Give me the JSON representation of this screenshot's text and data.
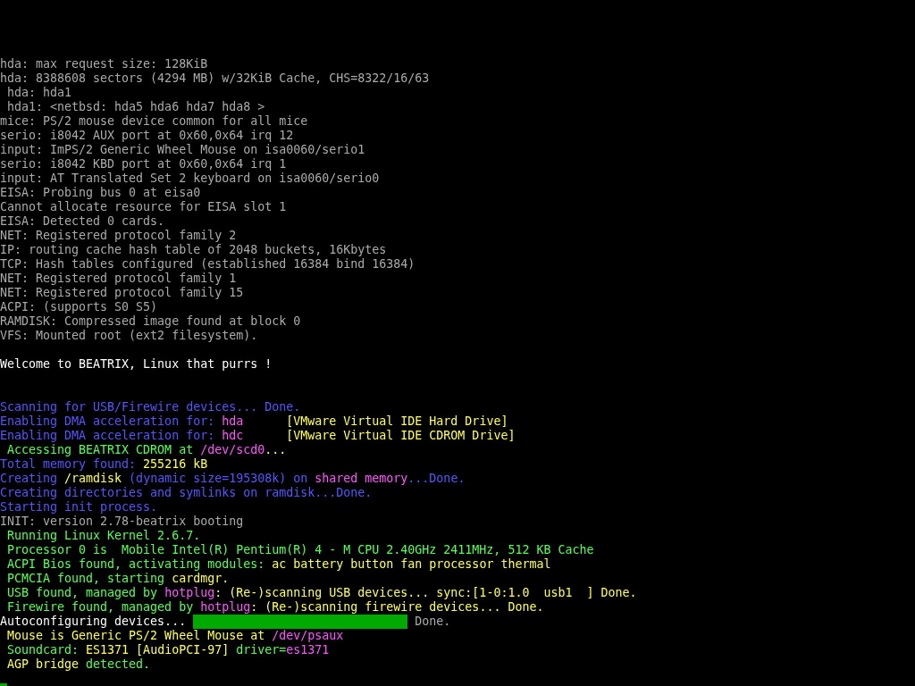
{
  "console": {
    "lines": [
      {
        "kind": "blank"
      },
      {
        "kind": "blank"
      },
      {
        "kind": "blank"
      },
      {
        "kind": "blank"
      },
      {
        "kind": "text",
        "segments": [
          {
            "text": "hda: max request size: 128KiB",
            "color": "#aaaaaa"
          }
        ]
      },
      {
        "kind": "text",
        "segments": [
          {
            "text": "hda: 8388608 sectors (4294 MB) w/32KiB Cache, CHS=8322/16/63",
            "color": "#aaaaaa"
          }
        ]
      },
      {
        "kind": "text",
        "segments": [
          {
            "text": " hda: hda1",
            "color": "#aaaaaa"
          }
        ]
      },
      {
        "kind": "text",
        "segments": [
          {
            "text": " hda1: <netbsd: hda5 hda6 hda7 hda8 >",
            "color": "#aaaaaa"
          }
        ]
      },
      {
        "kind": "text",
        "segments": [
          {
            "text": "mice: PS/2 mouse device common for all mice",
            "color": "#aaaaaa"
          }
        ]
      },
      {
        "kind": "text",
        "segments": [
          {
            "text": "serio: i8042 AUX port at 0x60,0x64 irq 12",
            "color": "#aaaaaa"
          }
        ]
      },
      {
        "kind": "text",
        "segments": [
          {
            "text": "input: ImPS/2 Generic Wheel Mouse on isa0060/serio1",
            "color": "#aaaaaa"
          }
        ]
      },
      {
        "kind": "text",
        "segments": [
          {
            "text": "serio: i8042 KBD port at 0x60,0x64 irq 1",
            "color": "#aaaaaa"
          }
        ]
      },
      {
        "kind": "text",
        "segments": [
          {
            "text": "input: AT Translated Set 2 keyboard on isa0060/serio0",
            "color": "#aaaaaa"
          }
        ]
      },
      {
        "kind": "text",
        "segments": [
          {
            "text": "EISA: Probing bus 0 at eisa0",
            "color": "#aaaaaa"
          }
        ]
      },
      {
        "kind": "text",
        "segments": [
          {
            "text": "Cannot allocate resource for EISA slot 1",
            "color": "#aaaaaa"
          }
        ]
      },
      {
        "kind": "text",
        "segments": [
          {
            "text": "EISA: Detected 0 cards.",
            "color": "#aaaaaa"
          }
        ]
      },
      {
        "kind": "text",
        "segments": [
          {
            "text": "NET: Registered protocol family 2",
            "color": "#aaaaaa"
          }
        ]
      },
      {
        "kind": "text",
        "segments": [
          {
            "text": "IP: routing cache hash table of 2048 buckets, 16Kbytes",
            "color": "#aaaaaa"
          }
        ]
      },
      {
        "kind": "text",
        "segments": [
          {
            "text": "TCP: Hash tables configured (established 16384 bind 16384)",
            "color": "#aaaaaa"
          }
        ]
      },
      {
        "kind": "text",
        "segments": [
          {
            "text": "NET: Registered protocol family 1",
            "color": "#aaaaaa"
          }
        ]
      },
      {
        "kind": "text",
        "segments": [
          {
            "text": "NET: Registered protocol family 15",
            "color": "#aaaaaa"
          }
        ]
      },
      {
        "kind": "text",
        "segments": [
          {
            "text": "ACPI: (supports S0 S5)",
            "color": "#aaaaaa"
          }
        ]
      },
      {
        "kind": "text",
        "segments": [
          {
            "text": "RAMDISK: Compressed image found at block 0",
            "color": "#aaaaaa"
          }
        ]
      },
      {
        "kind": "text",
        "segments": [
          {
            "text": "VFS: Mounted root (ext2 filesystem).",
            "color": "#aaaaaa"
          }
        ]
      },
      {
        "kind": "blank"
      },
      {
        "kind": "text",
        "segments": [
          {
            "text": "Welcome to BEATRIX, Linux that purrs !",
            "color": "#ffffff"
          }
        ]
      },
      {
        "kind": "blank"
      },
      {
        "kind": "blank"
      },
      {
        "kind": "text",
        "segments": [
          {
            "text": "Scanning for USB/Firewire devices... Done.",
            "color": "#5555ff"
          }
        ]
      },
      {
        "kind": "text",
        "segments": [
          {
            "text": "Enabling DMA acceleration for: ",
            "color": "#5555ff"
          },
          {
            "text": "hda      ",
            "color": "#ff55ff"
          },
          {
            "text": "[VMware Virtual IDE Hard Drive]",
            "color": "#ffff55"
          }
        ]
      },
      {
        "kind": "text",
        "segments": [
          {
            "text": "Enabling DMA acceleration for: ",
            "color": "#5555ff"
          },
          {
            "text": "hdc      ",
            "color": "#ff55ff"
          },
          {
            "text": "[VMware Virtual IDE CDROM Drive]",
            "color": "#ffff55"
          }
        ]
      },
      {
        "kind": "text",
        "segments": [
          {
            "text": " Accessing BEATRIX CDROM at ",
            "color": "#55ff55"
          },
          {
            "text": "/dev/scd0",
            "color": "#ff55ff"
          },
          {
            "text": "...",
            "color": "#ffff55"
          }
        ]
      },
      {
        "kind": "text",
        "segments": [
          {
            "text": "Total memory found: ",
            "color": "#5555ff"
          },
          {
            "text": "255216 kB",
            "color": "#ffff55"
          }
        ]
      },
      {
        "kind": "text",
        "segments": [
          {
            "text": "Creating ",
            "color": "#5555ff"
          },
          {
            "text": "/ramdisk",
            "color": "#ffff55"
          },
          {
            "text": " (dynamic size=195308k) on ",
            "color": "#5555ff"
          },
          {
            "text": "shared memory",
            "color": "#ff55ff"
          },
          {
            "text": "...Done.",
            "color": "#5555ff"
          }
        ]
      },
      {
        "kind": "text",
        "segments": [
          {
            "text": "Creating directories and symlinks on ramdisk...Done.",
            "color": "#5555ff"
          }
        ]
      },
      {
        "kind": "text",
        "segments": [
          {
            "text": "Starting init process.",
            "color": "#5555ff"
          }
        ]
      },
      {
        "kind": "text",
        "segments": [
          {
            "text": "INIT: version 2.78-beatrix booting",
            "color": "#aaaaaa"
          }
        ]
      },
      {
        "kind": "text",
        "segments": [
          {
            "text": " Running Linux Kernel 2.6.7.",
            "color": "#55ff55"
          }
        ]
      },
      {
        "kind": "text",
        "segments": [
          {
            "text": " Processor 0 is  Mobile Intel(R) Pentium(R) 4 - M CPU 2.40GHz 2411MHz, 512 KB Cache",
            "color": "#55ff55"
          }
        ]
      },
      {
        "kind": "text",
        "segments": [
          {
            "text": " ACPI Bios found, activating modules: ",
            "color": "#55ff55"
          },
          {
            "text": "ac battery button fan processor thermal",
            "color": "#ffff55"
          }
        ]
      },
      {
        "kind": "text",
        "segments": [
          {
            "text": " PCMCIA found, starting ",
            "color": "#55ff55"
          },
          {
            "text": "cardmgr.",
            "color": "#ffff55"
          }
        ]
      },
      {
        "kind": "text",
        "segments": [
          {
            "text": " USB found, managed by ",
            "color": "#55ff55"
          },
          {
            "text": "hotplug",
            "color": "#ff55ff"
          },
          {
            "text": ": (Re-)scanning USB devices... sync:[1-0:1.0  usb1  ] Done.",
            "color": "#ffff55"
          }
        ]
      },
      {
        "kind": "text",
        "segments": [
          {
            "text": " Firewire found, managed by ",
            "color": "#55ff55"
          },
          {
            "text": "hotplug",
            "color": "#ff55ff"
          },
          {
            "text": ": (Re-)scanning firewire devices... Done.",
            "color": "#ffff55"
          }
        ]
      },
      {
        "kind": "progress",
        "label": "Autoconfiguring devices... ",
        "level": 1,
        "status": "Done."
      },
      {
        "kind": "text",
        "segments": [
          {
            "text": " Mouse is Generic PS/2 Wheel Mouse at ",
            "color": "#ffff55"
          },
          {
            "text": "/dev/psaux",
            "color": "#ff55ff"
          }
        ]
      },
      {
        "kind": "text",
        "segments": [
          {
            "text": " Soundcard: ",
            "color": "#55ff55"
          },
          {
            "text": "ES1371 [AudioPCI-97]",
            "color": "#ffff55"
          },
          {
            "text": " driver=",
            "color": "#55ff55"
          },
          {
            "text": "es1371",
            "color": "#ff55ff"
          }
        ]
      },
      {
        "kind": "text",
        "segments": [
          {
            "text": " AGP bridge",
            "color": "#ffff55"
          },
          {
            "text": " detected.",
            "color": "#55ff55"
          }
        ]
      }
    ]
  }
}
